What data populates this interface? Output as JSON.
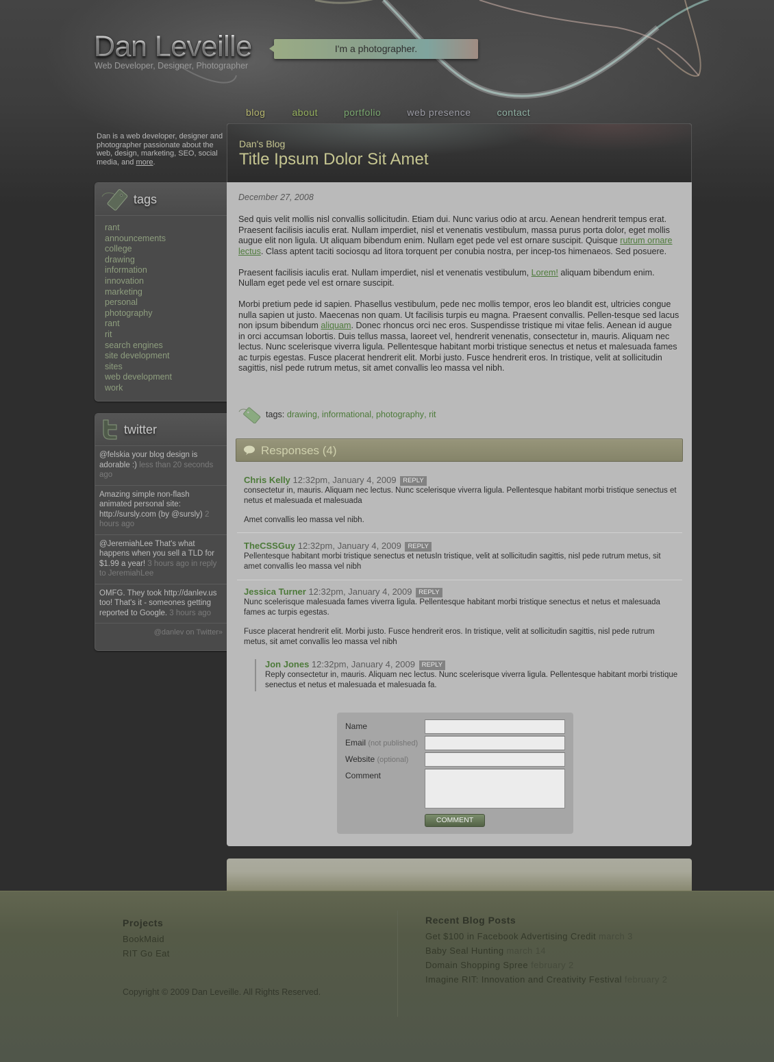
{
  "header": {
    "site_name": "Dan Leveille",
    "tagline": "Web Developer, Designer, Photographer",
    "speech_bubble": "I'm a photographer."
  },
  "nav": {
    "items": [
      {
        "label": "blog",
        "color": "#b5b56e"
      },
      {
        "label": "about",
        "color": "#95b05e"
      },
      {
        "label": "portfolio",
        "color": "#7aa76f"
      },
      {
        "label": "web presence",
        "color": "#9a9aa3"
      },
      {
        "label": "contact",
        "color": "#8fb0a3"
      }
    ]
  },
  "sidebar": {
    "intro_text": "Dan is a web developer, designer and photographer passionate about the web, design, marketing, SEO, social media, and ",
    "intro_link": "more",
    "intro_end": ".",
    "tags": {
      "title": "tags",
      "items": [
        "rant",
        "announcements",
        "college",
        "drawing",
        "information",
        "innovation",
        "marketing",
        "personal",
        "photography",
        "rant",
        "rit",
        "search engines",
        "site development",
        "sites",
        "web development",
        "work"
      ]
    },
    "twitter": {
      "title": "twitter",
      "tweets": [
        {
          "text": "@felskia your blog design is adorable :) ",
          "time": "less than 20 seconds ago"
        },
        {
          "text": "Amazing simple non-flash animated personal site: http://sursly.com (by @sursly) ",
          "time": "2 hours ago"
        },
        {
          "text": "@JeremiahLee That's what happens when you sell a TLD for $1.99 a year! ",
          "time": "3 hours ago in reply to JeremiahLee"
        },
        {
          "text": "OMFG. They took http://danlev.us too! That's it - someones getting reported to Google. ",
          "time": "3 hours ago"
        }
      ],
      "footer_link": "@danlev on Twitter»"
    }
  },
  "post": {
    "blog_label": "Dan's Blog",
    "title": "Title Ipsum Dolor Sit Amet",
    "date": "December 27, 2008",
    "p1_a": "Sed quis velit mollis nisl convallis sollicitudin. Etiam dui. Nunc varius odio at arcu. Aenean hendrerit tempus erat. Praesent facilisis iaculis erat. Nullam imperdiet, nisl et venenatis vestibulum, massa purus porta dolor, eget mollis augue elit non ligula. Ut aliquam bibendum enim. Nullam eget pede vel est ornare suscipit. Quisque ",
    "p1_link": "rutrum ornare lectus",
    "p1_b": ". Class aptent taciti sociosqu ad litora torquent per conubia nostra, per incep-tos himenaeos. Sed posuere.",
    "p2_a": "Praesent facilisis iaculis erat. Nullam imperdiet, nisl et venenatis vestibulum, ",
    "p2_link": "Lorem!",
    "p2_b": " aliquam bibendum enim. Nullam eget pede vel est ornare suscipit.",
    "p3_a": "Morbi pretium pede id sapien. Phasellus vestibulum, pede nec mollis tempor, eros leo blandit est, ultricies congue nulla sapien ut justo. Maecenas non quam. Ut facilisis turpis eu magna. Praesent convallis. Pellen-tesque sed lacus non ipsum bibendum ",
    "p3_link": "aliquam",
    "p3_b": ". Donec rhoncus orci nec eros. Suspendisse tristique mi vitae felis. Aenean id augue in orci accumsan lobortis. Duis tellus massa, laoreet vel, hendrerit venenatis, consectetur in, mauris. Aliquam nec lectus. Nunc scelerisque viverra ligula. Pellentesque habitant morbi tristique senectus et netus et malesuada fames ac turpis egestas. Fusce placerat hendrerit elit. Morbi justo. Fusce hendrerit eros. In tristique, velit at sollicitudin sagittis, nisl pede rutrum metus, sit amet convallis leo massa vel nibh.",
    "tags_label": "tags:",
    "tags": [
      "drawing",
      "informational",
      "photography",
      "rit"
    ]
  },
  "responses": {
    "title": "Responses (4)",
    "reply_label": "REPLY",
    "comments": [
      {
        "author": "Chris Kelly",
        "time": "12:32pm, January 4, 2009",
        "paragraphs": [
          "consectetur in, mauris. Aliquam nec lectus. Nunc scelerisque viverra ligula. Pellentesque habitant morbi tristique senectus et netus et malesuada et malesuada",
          "Amet convallis leo massa vel nibh."
        ]
      },
      {
        "author": "TheCSSGuy",
        "time": "12:32pm, January 4, 2009",
        "paragraphs": [
          "Pellentesque habitant morbi tristique senectus et netusIn tristique, velit at sollicitudin sagittis, nisl pede rutrum metus, sit amet convallis leo massa vel nibh"
        ]
      },
      {
        "author": "Jessica Turner",
        "time": "12:32pm, January 4, 2009",
        "paragraphs": [
          "Nunc scelerisque malesuada fames viverra ligula. Pellentesque habitant morbi tristique senectus et netus et malesuada fames ac turpis egestas.",
          "Fusce placerat hendrerit elit. Morbi justo. Fusce hendrerit eros. In tristique, velit at sollicitudin sagittis, nisl pede rutrum metus, sit amet convallis leo massa vel nibh"
        ]
      },
      {
        "author": "Jon Jones",
        "time": "12:32pm, January 4, 2009",
        "paragraphs": [
          "Reply consectetur in, mauris. Aliquam nec lectus. Nunc scelerisque viverra ligula. Pellentesque habitant morbi tristique senectus et netus et malesuada et malesuada fa."
        ]
      }
    ]
  },
  "comment_form": {
    "name_label": "Name",
    "email_label": "Email",
    "email_hint": "(not published)",
    "website_label": "Website",
    "website_hint": "(optional)",
    "comment_label": "Comment",
    "name_value": "",
    "email_value": "",
    "website_value": "",
    "comment_value": "",
    "submit_label": "COMMENT"
  },
  "footer": {
    "projects_title": "Projects",
    "projects": [
      "BookMaid",
      "RIT Go Eat"
    ],
    "copyright": "Copyright © 2009 Dan Leveille. All Rights Reserved.",
    "recent_title": "Recent Blog Posts",
    "recent_posts": [
      {
        "title": "Get $100 in Facebook Advertising Credit",
        "date": "march 3"
      },
      {
        "title": "Baby Seal Hunting",
        "date": "march 14"
      },
      {
        "title": "Domain Shopping Spree",
        "date": "february 2"
      },
      {
        "title": "Imagine RIT: Innovation and Creativity Festival",
        "date": "february 2"
      }
    ]
  }
}
